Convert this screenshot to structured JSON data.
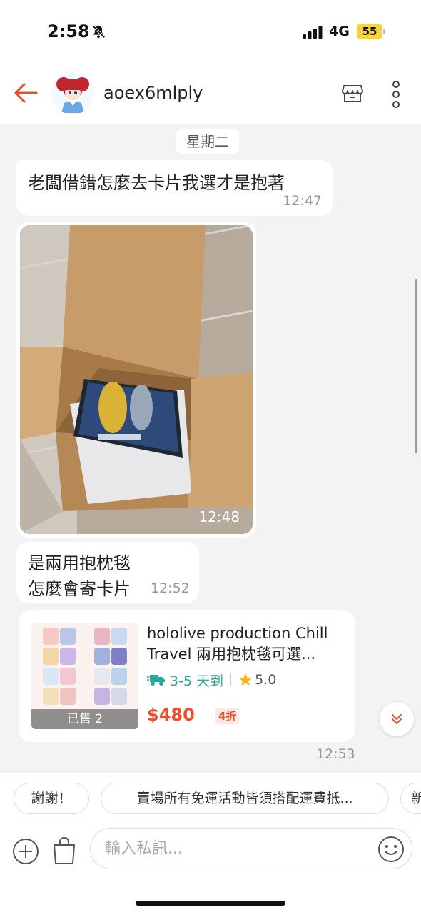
{
  "status_bar": {
    "time": "2:58",
    "network": "4G",
    "battery": "55"
  },
  "header": {
    "username": "aoex6mlply"
  },
  "chat": {
    "date_separator": "星期二",
    "messages": [
      {
        "text": "老闆借錯怎麼去卡片我選才是抱著",
        "time": "12:47"
      },
      {
        "type": "image",
        "time": "12:48"
      },
      {
        "line1": "是兩用抱枕毯",
        "line2": "怎麼會寄卡片",
        "time": "12:52"
      }
    ],
    "product_card": {
      "title_line1": "hololive production Chill",
      "title_line2": "Travel 兩用抱枕毯可選...",
      "delivery": "3-5 天到",
      "rating": "5.0",
      "price": "$480",
      "discount": "4折",
      "sold": "已售 2",
      "time": "12:53"
    }
  },
  "quick_replies": [
    "謝謝！",
    "賣場所有免運活動皆須搭配運費抵...",
    "新"
  ],
  "input": {
    "placeholder": "輸入私訊..."
  },
  "colors": {
    "brand": "#ee4d2d",
    "delivery": "#26aa99",
    "battery": "#f8d33a"
  }
}
